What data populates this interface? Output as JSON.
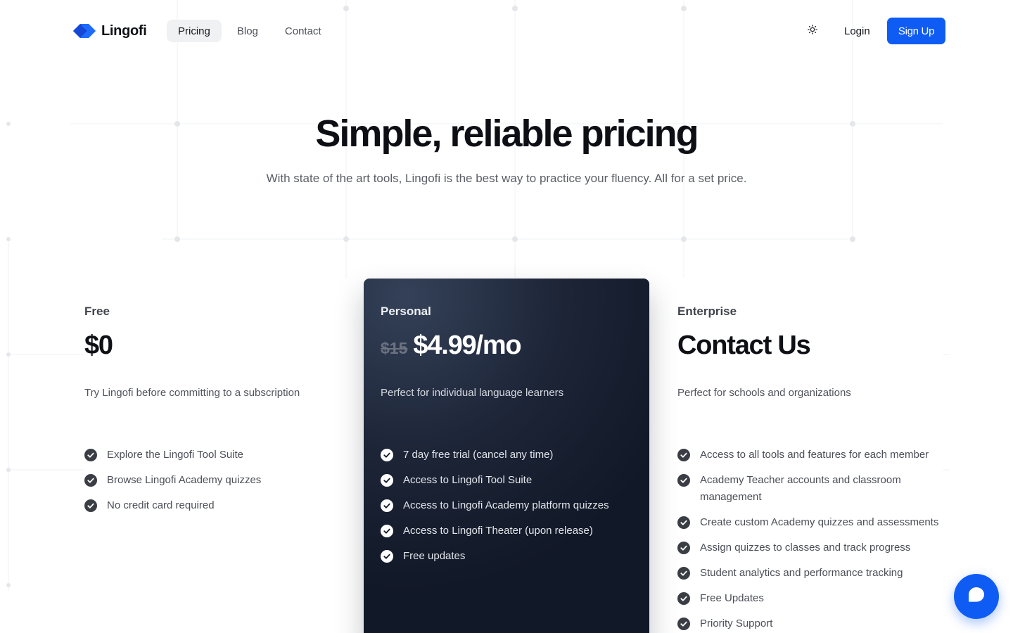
{
  "colors": {
    "accent": "#0f5cf5",
    "dark_card": "#111827"
  },
  "brand": {
    "name": "Lingofi",
    "logo_icon": "lingofi-diamond-logo"
  },
  "nav": {
    "items": [
      {
        "label": "Pricing",
        "active": true
      },
      {
        "label": "Blog",
        "active": false
      },
      {
        "label": "Contact",
        "active": false
      }
    ]
  },
  "header": {
    "theme_icon": "sun-icon",
    "login_label": "Login",
    "signup_label": "Sign Up"
  },
  "hero": {
    "title": "Simple, reliable pricing",
    "subtitle": "With state of the art tools, Lingofi is the best way to practice your fluency. All for a set price."
  },
  "plans": [
    {
      "name": "Free",
      "price": "$0",
      "old_price": "",
      "description": "Try Lingofi before committing to a subscription",
      "features": [
        "Explore the Lingofi Tool Suite",
        "Browse Lingofi Academy quizzes",
        "No credit card required"
      ]
    },
    {
      "name": "Personal",
      "price": "$4.99/mo",
      "old_price": "$15",
      "description": "Perfect for individual language learners",
      "features": [
        "7 day free trial (cancel any time)",
        "Access to Lingofi Tool Suite",
        "Access to Lingofi Academy platform quizzes",
        "Access to Lingofi Theater (upon release)",
        "Free updates"
      ]
    },
    {
      "name": "Enterprise",
      "price": "Contact Us",
      "old_price": "",
      "description": "Perfect for schools and organizations",
      "features": [
        "Access to all tools and features for each member",
        "Academy Teacher accounts and classroom management",
        "Create custom Academy quizzes and assessments",
        "Assign quizzes to classes and track progress",
        "Student analytics and performance tracking",
        "Free Updates",
        "Priority Support"
      ]
    }
  ],
  "chat": {
    "icon": "chat-bubble-icon"
  }
}
